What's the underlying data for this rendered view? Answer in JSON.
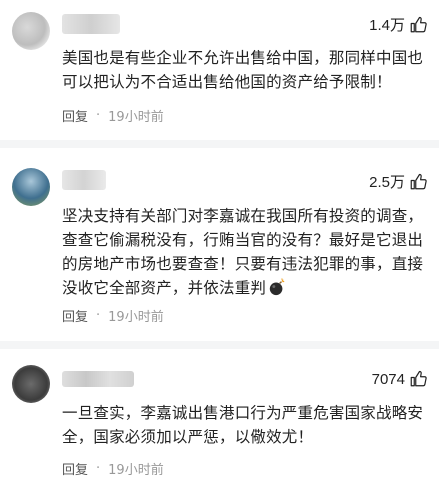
{
  "comments": [
    {
      "likes": "1.4万",
      "text_lines": [
        "美国也是有些企业不允许出售给中国，那同样中国也",
        "可以把认为不合适出售给他国的资产给予限制！"
      ],
      "reply_label": "回复",
      "separator": "·",
      "time": "19小时前"
    },
    {
      "likes": "2.5万",
      "text_lines": [
        "坚决支持有关部门对李嘉诚在我国所有投资的调查，",
        "查查它偷漏税没有，行贿当官的没有？最好是它退出",
        "的房地产市场也要查查！只要有违法犯罪的事，直接",
        "没收它全部资产，并依法重判"
      ],
      "reply_label": "回复",
      "separator": "·",
      "time": "19小时前"
    },
    {
      "likes": "7074",
      "text_lines": [
        "一旦查实，李嘉诚出售港口行为严重危害国家战略安",
        "全，国家必须加以严惩，以儆效尤！"
      ],
      "reply_label": "回复",
      "separator": "·",
      "time": "19小时前"
    }
  ],
  "icons": {
    "like": "thumbs-up-icon",
    "emoji": "bomb-emoji-icon"
  },
  "colors": {
    "text": "#222222",
    "meta": "#999999",
    "divider": "#f4f5f6"
  }
}
